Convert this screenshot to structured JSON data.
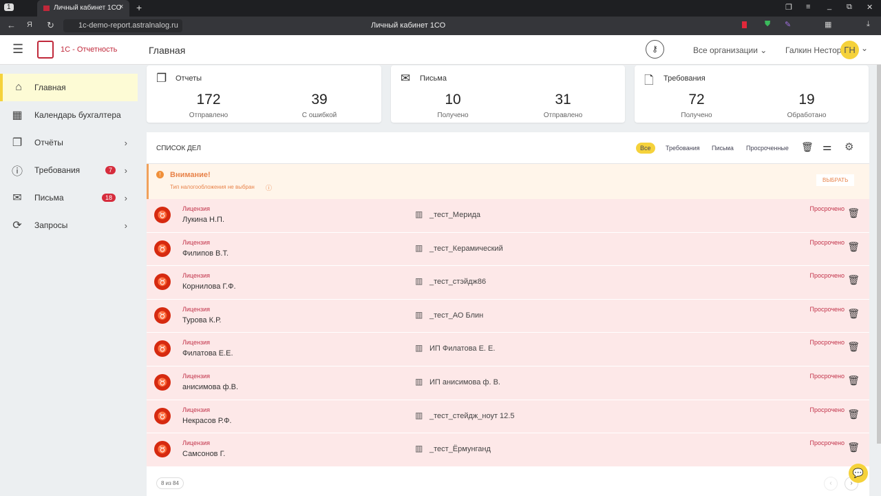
{
  "browser": {
    "tab_number": "1",
    "tab_title": "Личный кабинет 1СО",
    "url": "1c-demo-report.astralnalog.ru",
    "page_title": "Личный кабинет 1СО"
  },
  "header": {
    "brand": "1С - Отчетность",
    "title": "Главная",
    "org_select": "Все организации",
    "user_name": "Галкин Нестор",
    "user_initials": "ГН"
  },
  "sidebar": {
    "items": [
      {
        "label": "Главная",
        "icon": "home-icon",
        "active": true
      },
      {
        "label": "Календарь бухгалтера",
        "icon": "calendar-icon"
      },
      {
        "label": "Отчёты",
        "icon": "reports-icon",
        "chevron": true
      },
      {
        "label": "Требования",
        "icon": "alert-icon",
        "badge": "7",
        "chevron": true
      },
      {
        "label": "Письма",
        "icon": "mail-icon",
        "badge": "18",
        "chevron": true
      },
      {
        "label": "Запросы",
        "icon": "sync-icon",
        "chevron": true
      }
    ]
  },
  "cards": [
    {
      "title": "Отчеты",
      "a_value": "172",
      "a_label": "Отправлено",
      "b_value": "39",
      "b_label": "С ошибкой"
    },
    {
      "title": "Письма",
      "a_value": "10",
      "a_label": "Получено",
      "b_value": "31",
      "b_label": "Отправлено"
    },
    {
      "title": "Требования",
      "a_value": "72",
      "a_label": "Получено",
      "b_value": "19",
      "b_label": "Обработано"
    }
  ],
  "tasks": {
    "title": "СПИСОК ДЕЛ",
    "filters": [
      "Все",
      "Требования",
      "Письма",
      "Просроченные"
    ],
    "active_filter": "Все",
    "warning": {
      "title": "Внимание!",
      "text": "Тип налогообложения не выбран",
      "action": "ВЫБРАТЬ"
    },
    "rows": [
      {
        "type": "Лицензия",
        "name": "Лукина Н.П.",
        "org": "_тест_Мерида",
        "status": "Просрочено"
      },
      {
        "type": "Лицензия",
        "name": "Филипов В.Т.",
        "org": "_тест_Керамический",
        "status": "Просрочено"
      },
      {
        "type": "Лицензия",
        "name": "Корнилова Г.Ф.",
        "org": "_тест_стэйдж86",
        "status": "Просрочено"
      },
      {
        "type": "Лицензия",
        "name": "Турова К.Р.",
        "org": "_тест_АО Блин",
        "status": "Просрочено"
      },
      {
        "type": "Лицензия",
        "name": "Филатова Е.Е.",
        "org": "ИП Филатова Е. Е.",
        "status": "Просрочено"
      },
      {
        "type": "Лицензия",
        "name": "анисимова ф.В.",
        "org": "ИП анисимова ф. В.",
        "status": "Просрочено"
      },
      {
        "type": "Лицензия",
        "name": "Некрасов Р.Ф.",
        "org": "_тест_стейдж_ноут 12.5",
        "status": "Просрочено"
      },
      {
        "type": "Лицензия",
        "name": "Самсонов Г.",
        "org": "_тест_Ёрмунганд",
        "status": "Просрочено"
      }
    ],
    "pager": "8 из 84"
  },
  "colors": {
    "accent": "#f5d23b",
    "danger": "#d62a10",
    "row_bg": "#fde8e8"
  }
}
